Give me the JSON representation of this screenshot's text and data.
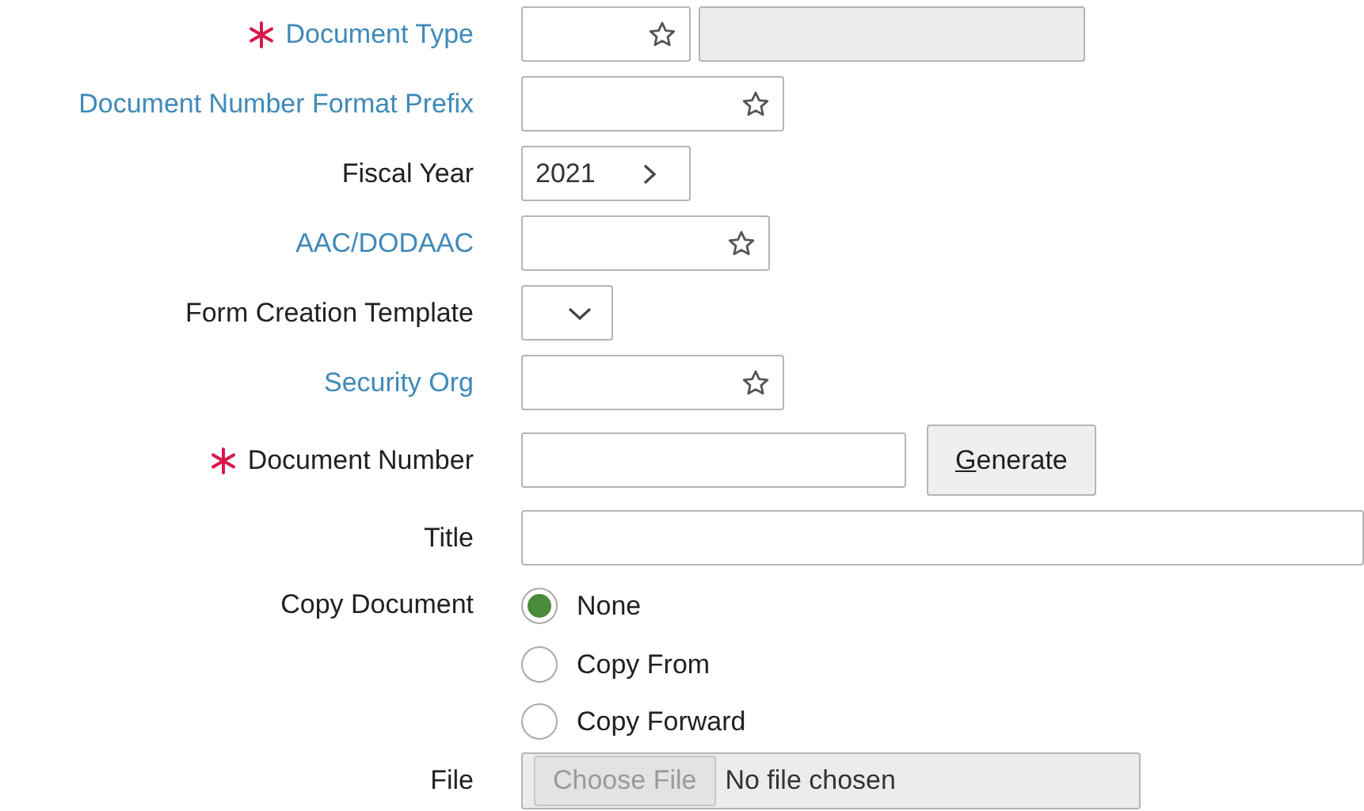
{
  "fields": [
    {
      "kind": "lookup",
      "label": "Document Type",
      "required": true,
      "link": true,
      "description_box": true
    },
    {
      "kind": "lookup",
      "label": "Document Number Format Prefix",
      "required": false,
      "link": true
    },
    {
      "kind": "stepper",
      "label": "Fiscal Year",
      "required": false,
      "link": false,
      "value": "2021"
    },
    {
      "kind": "lookup",
      "label": "AAC/DODAAC",
      "required": false,
      "link": true
    },
    {
      "kind": "select",
      "label": "Form Creation Template",
      "required": false,
      "link": false
    },
    {
      "kind": "lookup",
      "label": "Security Org",
      "required": false,
      "link": true
    },
    {
      "kind": "text_button",
      "label": "Document Number",
      "required": true,
      "link": false,
      "button": "Generate",
      "access_key_underlined": true
    },
    {
      "kind": "text",
      "label": "Title",
      "required": false,
      "link": false
    },
    {
      "kind": "radios",
      "label": "Copy Document",
      "required": false,
      "link": false,
      "options": [
        {
          "label": "None",
          "selected": true
        },
        {
          "label": "Copy From",
          "selected": false
        },
        {
          "label": "Copy Forward",
          "selected": false
        }
      ]
    },
    {
      "kind": "file",
      "label": "File",
      "required": false,
      "link": false,
      "button": "Choose File",
      "status": "No file chosen",
      "disabled": true
    }
  ]
}
